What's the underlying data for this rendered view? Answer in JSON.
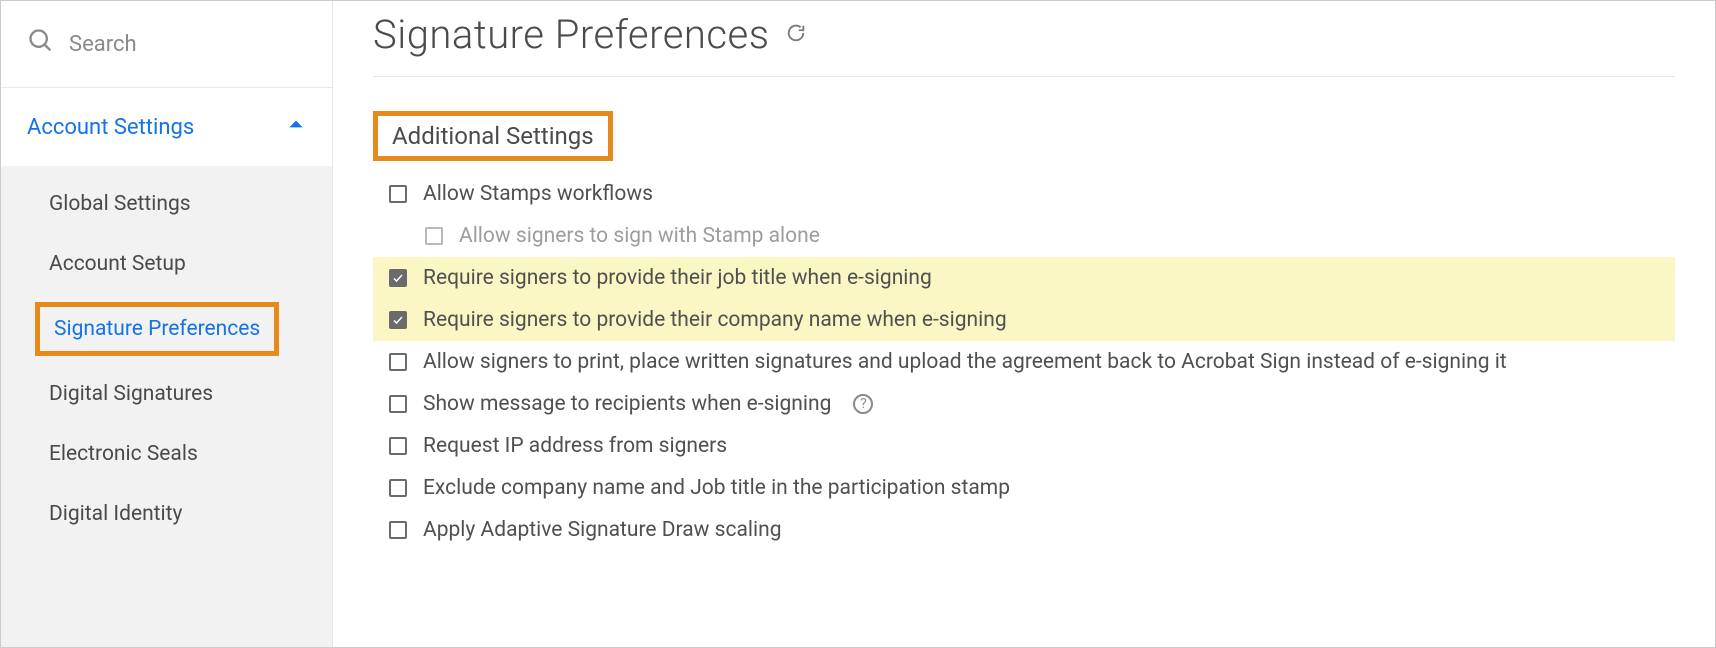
{
  "search": {
    "placeholder": "Search"
  },
  "sidebar": {
    "section_label": "Account Settings",
    "items": [
      {
        "label": "Global Settings",
        "active": false
      },
      {
        "label": "Account Setup",
        "active": false
      },
      {
        "label": "Signature Preferences",
        "active": true,
        "boxed": true
      },
      {
        "label": "Digital Signatures",
        "active": false
      },
      {
        "label": "Electronic Seals",
        "active": false
      },
      {
        "label": "Digital Identity",
        "active": false
      }
    ]
  },
  "main": {
    "title": "Signature Preferences",
    "section_title": "Additional Settings",
    "options": [
      {
        "label": "Allow Stamps workflows",
        "checked": false,
        "indent": false,
        "highlight": false,
        "disabled": false
      },
      {
        "label": "Allow signers to sign with Stamp alone",
        "checked": false,
        "indent": true,
        "highlight": false,
        "disabled": true
      },
      {
        "label": "Require signers to provide their job title when e-signing",
        "checked": true,
        "indent": false,
        "highlight": true,
        "disabled": false
      },
      {
        "label": "Require signers to provide their company name when e-signing",
        "checked": true,
        "indent": false,
        "highlight": true,
        "disabled": false
      },
      {
        "label": "Allow signers to print, place written signatures and upload the agreement back to Acrobat Sign instead of e-signing it",
        "checked": false,
        "indent": false,
        "highlight": false,
        "disabled": false
      },
      {
        "label": "Show message to recipients when e-signing",
        "checked": false,
        "indent": false,
        "highlight": false,
        "disabled": false,
        "help": true
      },
      {
        "label": "Request IP address from signers",
        "checked": false,
        "indent": false,
        "highlight": false,
        "disabled": false
      },
      {
        "label": "Exclude company name and Job title in the participation stamp",
        "checked": false,
        "indent": false,
        "highlight": false,
        "disabled": false
      },
      {
        "label": "Apply Adaptive Signature Draw scaling",
        "checked": false,
        "indent": false,
        "highlight": false,
        "disabled": false
      }
    ]
  },
  "colors": {
    "accent": "#1473e6",
    "highlight_box": "#e68a19",
    "highlight_row": "#fbf7c4"
  }
}
